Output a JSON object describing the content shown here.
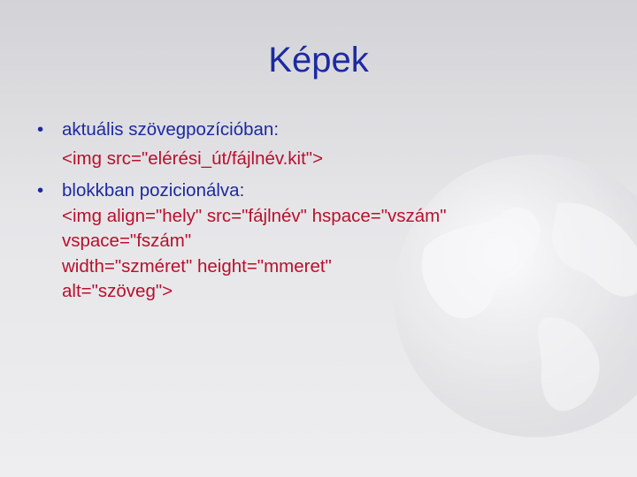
{
  "colors": {
    "title": "#1c2aa0",
    "text": "#1c2aa0",
    "code": "#b8102c",
    "background": "#e2e2e5"
  },
  "slide": {
    "title": "Képek",
    "bullet_symbol": "•",
    "bullets": [
      {
        "text": "aktuális szövegpozícióban:",
        "code_lines": [
          "<img src=\"elérési_út/fájlnév.kit\">"
        ]
      },
      {
        "text": "blokkban pozicionálva:",
        "code_lines": [
          "<img align=\"hely\" src=\"fájlnév\" hspace=\"vszám\"",
          "vspace=\"fszám\"",
          "width=\"szméret\" height=\"mmeret\"",
          "alt=\"szöveg\">"
        ]
      }
    ]
  }
}
